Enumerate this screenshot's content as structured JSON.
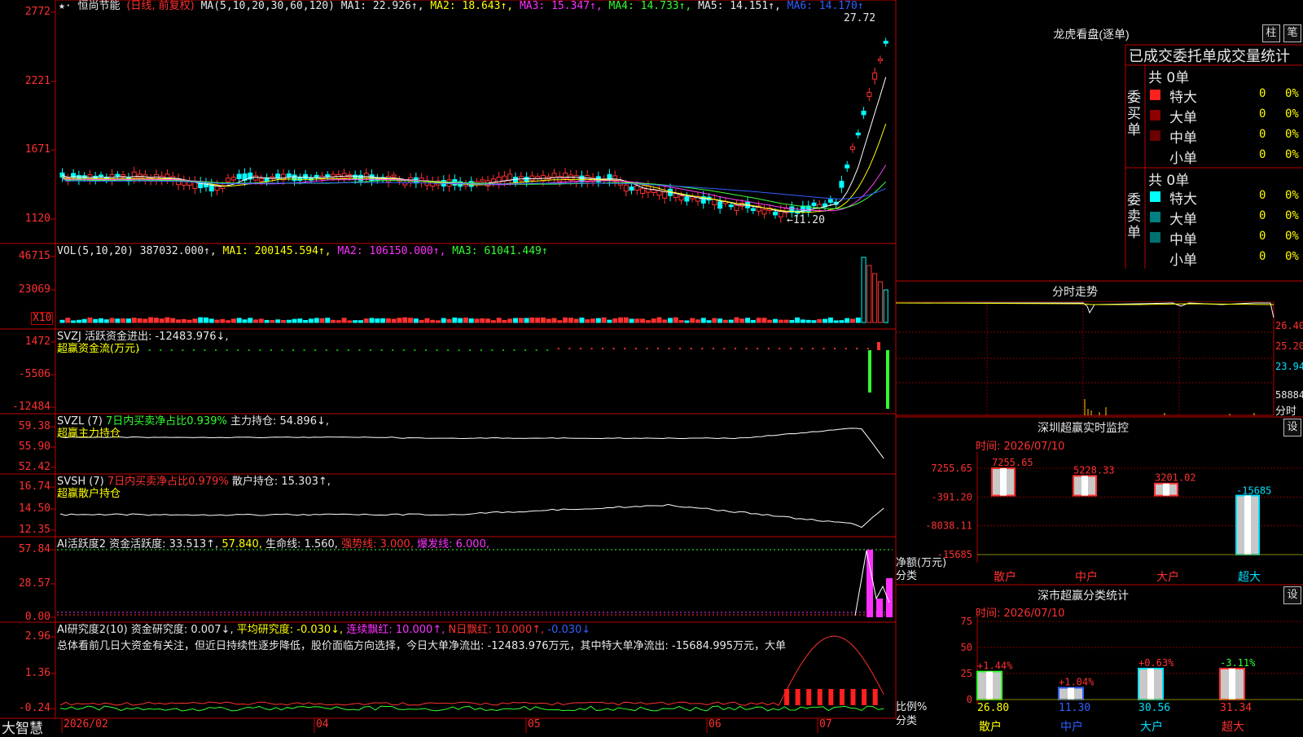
{
  "main": {
    "stock_name": "恒尚节能",
    "period_label": "(日线, 前复权)",
    "ma_header": "MA(5,10,20,30,60,120)",
    "ma1": "MA1: 22.926↑,",
    "ma2": "MA2: 18.643↑,",
    "ma3": "MA3: 15.347↑,",
    "ma4": "MA4: 14.733↑,",
    "ma5": "MA5: 14.151↑,",
    "ma6": "MA6: 14.170↑",
    "y_ticks": [
      "2772",
      "2221",
      "1671",
      "1120"
    ],
    "high_label": "27.72",
    "low_label": "←11.20"
  },
  "vol": {
    "header": "VOL(5,10,20)",
    "value": "387032.000↑,",
    "ma1": "MA1: 200145.594↑,",
    "ma2": "MA2: 106150.000↑,",
    "ma3": "MA3: 61041.449↑",
    "y_ticks": [
      "46715",
      "23069"
    ],
    "multiplier": "X10"
  },
  "svzj": {
    "header": "SVZJ  活跃资金进出: -12483.976↓,",
    "sub": "超赢资金流(万元)",
    "y_ticks": [
      "1472",
      "-5506",
      "-12484"
    ]
  },
  "svzl": {
    "header_a": "SVZL (7)",
    "header_b": "7日内买卖净占比0.939%",
    "header_c": "主力持仓: 54.896↓,",
    "sub": "超赢主力持仓",
    "y_ticks": [
      "59.38",
      "55.90",
      "52.42"
    ]
  },
  "svsh": {
    "header_a": "SVSH (7)",
    "header_b": "7日内买卖净占比0.979%",
    "header_c": "散户持仓: 15.303↑,",
    "sub": "超赢散户持仓",
    "y_ticks": [
      "16.74",
      "14.50",
      "12.35"
    ]
  },
  "ai1": {
    "header_a": "AI活跃度2",
    "header_b": "资金活跃度: 33.513↑,",
    "header_c": "57.840,",
    "header_d": "生命线: 1.560,",
    "header_e": "强势线: 3.000,",
    "header_f": "爆发线: 6.000,",
    "y_ticks": [
      "57.84",
      "28.57",
      "0.00"
    ]
  },
  "ai2": {
    "header_a": "AI研究度2(10)",
    "header_b": "资金研究度: 0.007↓,",
    "header_c": "平均研究度: -0.030↓,",
    "header_d": "连续飘红: 10.000↑,",
    "header_e": "N日飘红: 10.000↑,",
    "header_f": "-0.030↓",
    "comment": "总体看前几日大资金有关注，但近日持续性逐步降低，股价面临方向选择，今日大单净流出: -12483.976万元，其中特大单净流出: -15684.995万元，大单",
    "y_ticks": [
      "2.96",
      "1.36",
      "-0.24"
    ]
  },
  "xaxis": {
    "brand": "大智慧",
    "labels": [
      "2026/02",
      "04",
      "05",
      "06",
      "07"
    ]
  },
  "right": {
    "longhu_title": "龙虎看盘(逐单)",
    "btn_zhu": "柱",
    "btn_bi": "笔",
    "stats_title": "已成交委托单成交量统计",
    "buy_side": "委买单",
    "sell_side": "委卖单",
    "buy_total": "共 0单",
    "sell_total": "共 0单",
    "buy_rows": [
      {
        "label": "特大",
        "count": "0",
        "pct": "0%",
        "color": "#ff2020"
      },
      {
        "label": "大单",
        "count": "0",
        "pct": "0%",
        "color": "#8b0000"
      },
      {
        "label": "中单",
        "count": "0",
        "pct": "0%",
        "color": "#6a0000"
      },
      {
        "label": "小单",
        "count": "0",
        "pct": "0%",
        "color": ""
      }
    ],
    "sell_rows": [
      {
        "label": "特大",
        "count": "0",
        "pct": "0%",
        "color": "#00ffff"
      },
      {
        "label": "大单",
        "count": "0",
        "pct": "0%",
        "color": "#008080"
      },
      {
        "label": "中单",
        "count": "0",
        "pct": "0%",
        "color": "#007070"
      },
      {
        "label": "小单",
        "count": "0",
        "pct": "0%",
        "color": ""
      }
    ],
    "intraday_title": "分时走势",
    "intraday_ticks": [
      "26.40",
      "25.20",
      "23.94",
      "58884",
      "分时"
    ],
    "monitor_title": "深圳超赢实时监控",
    "set_btn": "设",
    "monitor_time": "时间: 2026/07/10",
    "monitor_yticks": [
      "7255.65",
      "-391.20",
      "-8038.11",
      "-15685"
    ],
    "monitor_ylabel": "净额(万元)",
    "monitor_xlabel": "分类",
    "classify_title": "深市超赢分类统计",
    "classify_time": "时间: 2026/07/10",
    "classify_yticks": [
      "75",
      "50",
      "25",
      "0"
    ],
    "classify_ylabel": "比例%",
    "classify_xlabel": "分类"
  },
  "chart_data": [
    {
      "type": "bar",
      "title": "深圳超赢实时监控",
      "ylabel": "净额(万元)",
      "xlabel": "分类",
      "categories": [
        "散户",
        "中户",
        "大户",
        "超大"
      ],
      "values": [
        7255.65,
        5228.33,
        3201.02,
        -15685
      ],
      "ylim": [
        -15685,
        7255.65
      ],
      "grid": true
    },
    {
      "type": "bar",
      "title": "深市超赢分类统计",
      "ylabel": "比例%",
      "xlabel": "分类",
      "categories": [
        "散户",
        "中户",
        "大户",
        "超大"
      ],
      "values": [
        26.8,
        11.3,
        30.56,
        31.34
      ],
      "changes": [
        "+1.44%",
        "+1.04%",
        "+0.63%",
        "-3.11%"
      ],
      "ylim": [
        0,
        75
      ],
      "grid": true
    }
  ]
}
